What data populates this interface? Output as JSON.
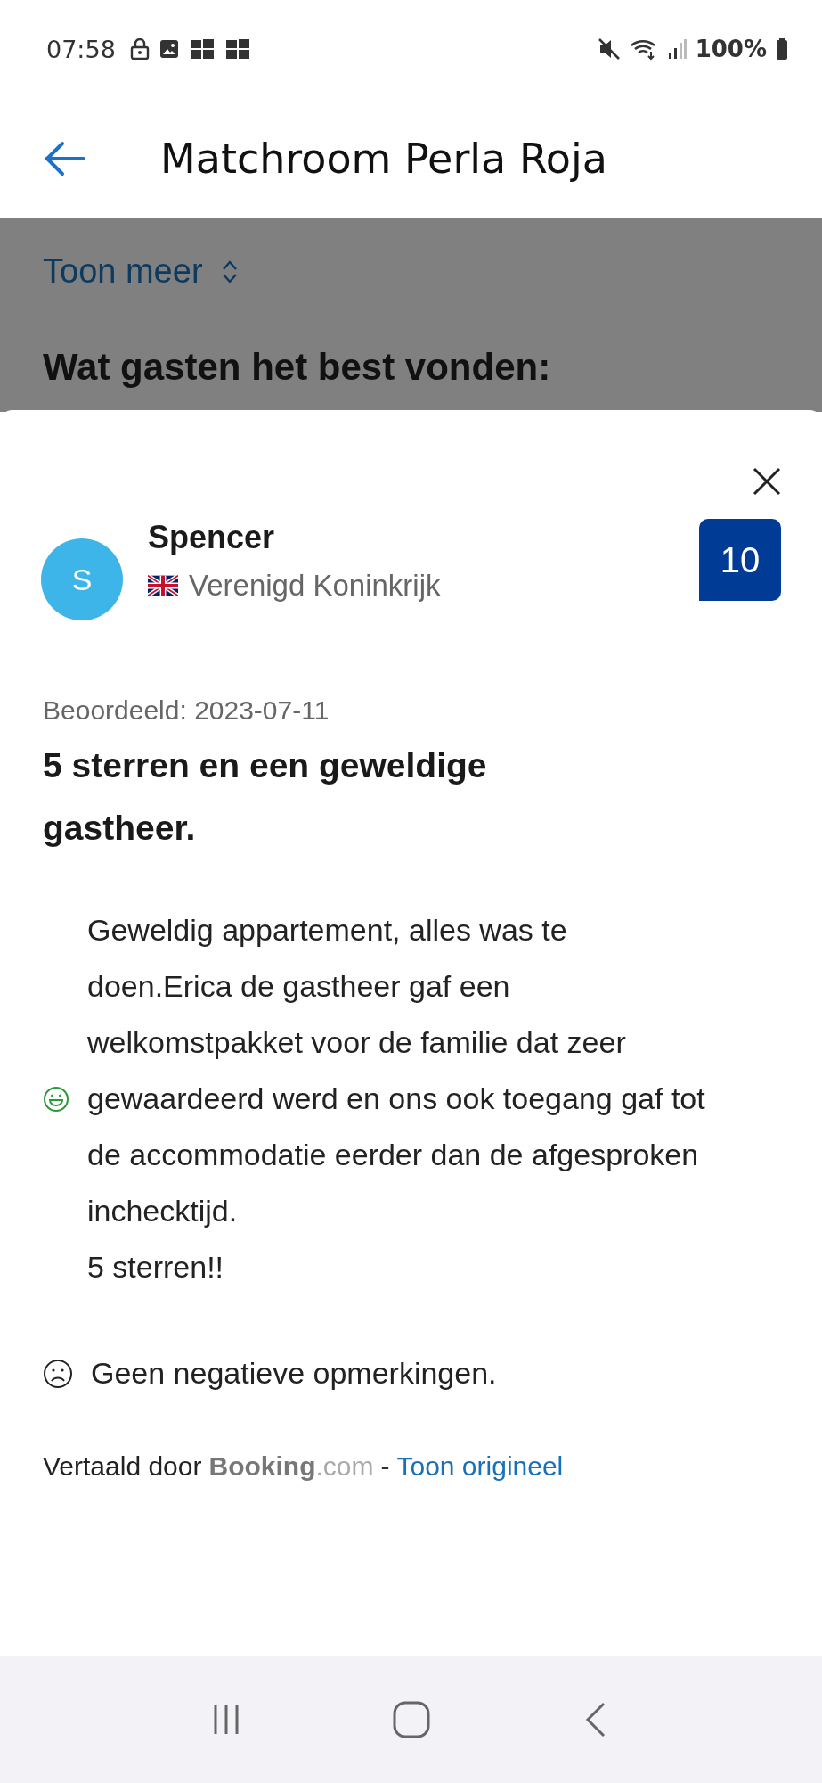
{
  "status_bar": {
    "time": "07:58",
    "battery": "100%"
  },
  "header": {
    "title": "Matchroom Perla Roja"
  },
  "background": {
    "toggle": "Toon meer",
    "heading": "Wat gasten het best vonden:"
  },
  "review": {
    "avatar_letter": "S",
    "name": "Spencer",
    "country": "Verenigd Koninkrijk",
    "score": "10",
    "date": "Beoordeeld: 2023-07-11",
    "title": "5 sterren en een geweldige gastheer.",
    "comments": [
      {
        "kind": "positive",
        "text": "Geweldig appartement, alles was te doen.Erica de gastheer gaf een welkomstpakket voor de familie dat zeer gewaardeerd werd en ons ook toegang gaf tot de accommodatie eerder dan de afgesproken inchecktijd.\n5 sterren!!"
      },
      {
        "kind": "negative",
        "text": "Geen negatieve opmerkingen."
      }
    ],
    "translation": {
      "label": "Vertaald door",
      "brand": "Booking",
      "brand_suffix": ".com",
      "separator": "-",
      "link": "Toon origineel"
    }
  }
}
